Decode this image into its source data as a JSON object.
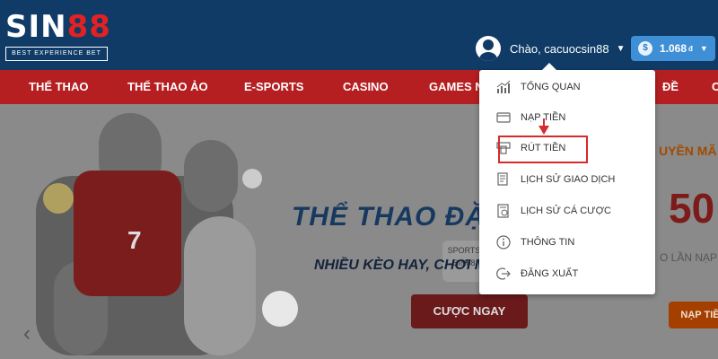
{
  "header": {
    "logo_main": "SIN",
    "logo_accent": "88",
    "logo_tagline": "BEST EXPERIENCE BET",
    "greeting": "Chào, cacuocsin88",
    "balance": "1.068",
    "balance_unit": "đ"
  },
  "nav": {
    "items": [
      {
        "label": "THỂ THAO"
      },
      {
        "label": "THỂ THAO ẢO"
      },
      {
        "label": "E-SPORTS"
      },
      {
        "label": "CASINO"
      },
      {
        "label": "GAMES NI"
      },
      {
        "label": "ĐỀ"
      },
      {
        "label": "C"
      }
    ]
  },
  "banner": {
    "sports_logo_line1": "SPORTS",
    "sports_logo_line2": "SIN88",
    "title": "THỂ THAO ĐẶC",
    "subtitle": "NHIỀU KÈO HAY, CHƠI M",
    "cta": "CƯỢC NGAY",
    "jersey_number": "7",
    "promo_head": "UYỀN MÃ",
    "promo_big": "50",
    "promo_small": "O LẦN NẠP",
    "promo_button": "NẠP TIỀ"
  },
  "dropdown": {
    "items": [
      {
        "label": "TỔNG QUAN",
        "icon": "chart-icon"
      },
      {
        "label": "NẠP TIỀN",
        "icon": "card-icon"
      },
      {
        "label": "RÚT TIỀN",
        "icon": "withdraw-icon"
      },
      {
        "label": "LỊCH SỬ GIAO DỊCH",
        "icon": "history-icon"
      },
      {
        "label": "LỊCH SỬ CÁ CƯỢC",
        "icon": "bet-history-icon"
      },
      {
        "label": "THÔNG TIN",
        "icon": "info-icon"
      },
      {
        "label": "ĐĂNG XUẤT",
        "icon": "logout-icon"
      }
    ]
  },
  "colors": {
    "header_bg": "#0f3b66",
    "nav_bg": "#b51f22",
    "highlight": "#d62b2b",
    "balance_bg": "#3f8fd6"
  }
}
